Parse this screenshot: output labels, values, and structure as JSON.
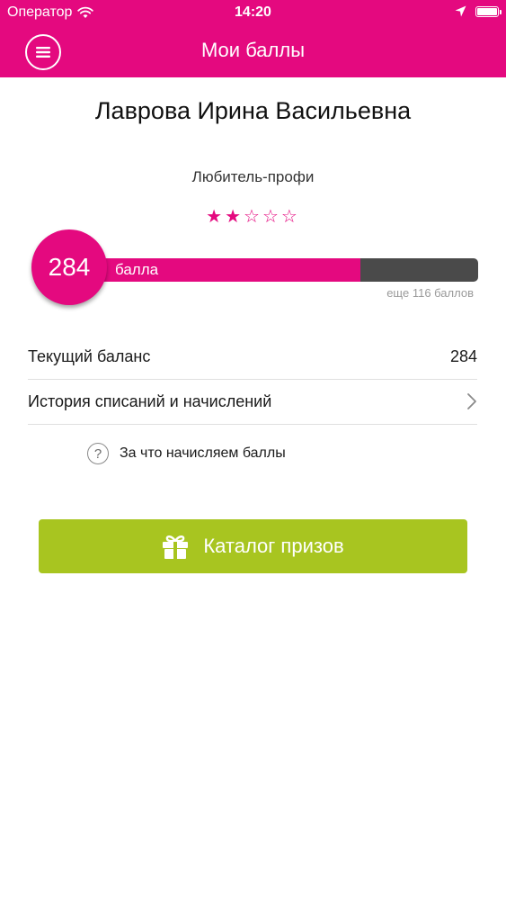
{
  "status_bar": {
    "carrier": "Оператор",
    "time": "14:20"
  },
  "header": {
    "title": "Мои баллы",
    "background_color": "#e4097f"
  },
  "profile": {
    "name": "Лаврова Ирина Васильевна",
    "level": "Любитель-профи",
    "stars_filled": 2,
    "stars_total": 5
  },
  "points": {
    "value": "284",
    "unit_label": "балла",
    "progress_fraction": 0.71,
    "remaining_text": "еще 116 баллов"
  },
  "rows": {
    "balance_label": "Текущий баланс",
    "balance_value": "284",
    "history_label": "История списаний и начислений"
  },
  "info_link": {
    "label": "За что начисляем баллы",
    "icon_text": "?"
  },
  "catalog_button": {
    "label": "Каталог призов",
    "color": "#a8c520"
  },
  "icons": {
    "menu": "menu-icon",
    "wifi": "wifi-icon",
    "location": "location-arrow-icon",
    "battery": "battery-icon",
    "chevron": "chevron-right-icon",
    "question": "question-icon",
    "gift": "gift-icon"
  }
}
